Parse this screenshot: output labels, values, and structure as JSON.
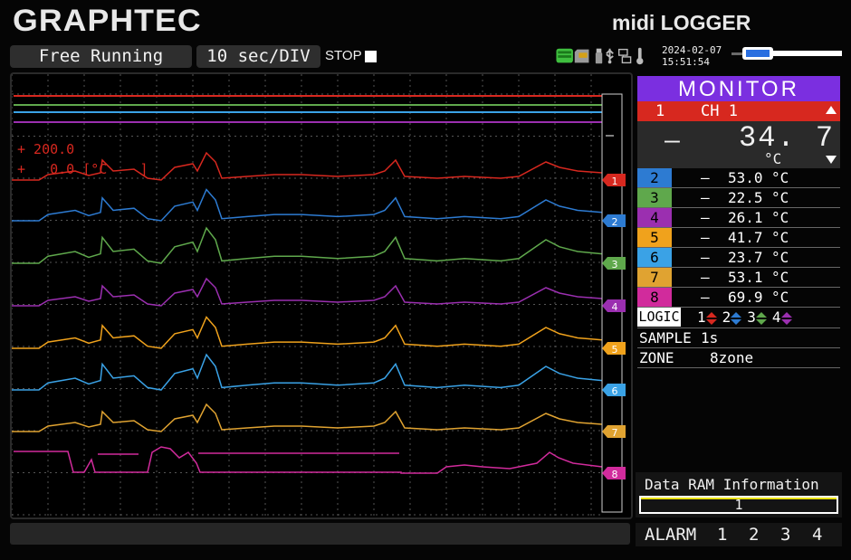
{
  "header": {
    "brand": "GRAPHTEC",
    "model": "midi LOGGER",
    "mode": "Free Running",
    "timebase": "10 sec/DIV",
    "status": "STOP",
    "date": "2024-02-07",
    "time": "15:51:54"
  },
  "status_icons": [
    "battery-icon",
    "sd-card-icon",
    "usb-memory-icon",
    "usb-icon",
    "network-icon",
    "temperature-icon"
  ],
  "graph": {
    "scale_upper": "+ 200.0",
    "scale_lower": "+   0.0 [°C    ]",
    "channel_markers": [
      "1",
      "2",
      "3",
      "4",
      "5",
      "6",
      "7",
      "8"
    ],
    "colors": [
      "#d7281f",
      "#2d7bd2",
      "#5fa84c",
      "#9b2fb0",
      "#f0a21c",
      "#3aa2e6",
      "#e0a331",
      "#d12b9c"
    ]
  },
  "monitor": {
    "title": "MONITOR",
    "selected_channel": {
      "number": "1",
      "label": "CH 1",
      "sign": "—",
      "value": "34. 7",
      "unit": "°C"
    },
    "channels": [
      {
        "number": "2",
        "sign": "—",
        "value": "53.0",
        "unit": "°C",
        "color": "#2d7bd2"
      },
      {
        "number": "3",
        "sign": "—",
        "value": "22.5",
        "unit": "°C",
        "color": "#5fa84c"
      },
      {
        "number": "4",
        "sign": "—",
        "value": "26.1",
        "unit": "°C",
        "color": "#9b2fb0"
      },
      {
        "number": "5",
        "sign": "—",
        "value": "41.7",
        "unit": "°C",
        "color": "#f0a21c"
      },
      {
        "number": "6",
        "sign": "—",
        "value": "23.7",
        "unit": "°C",
        "color": "#3aa2e6"
      },
      {
        "number": "7",
        "sign": "—",
        "value": "53.1",
        "unit": "°C",
        "color": "#e0a331"
      },
      {
        "number": "8",
        "sign": "—",
        "value": "69.9",
        "unit": "°C",
        "color": "#d12b9c"
      }
    ],
    "logic_label": "LOGIC",
    "logic_items": [
      "1",
      "2",
      "3",
      "4"
    ],
    "sample_label": "SAMPLE",
    "sample_value": "1s",
    "zone_label": "ZONE",
    "zone_value": "8zone"
  },
  "data_ram": {
    "title": "Data RAM Information",
    "value": "1"
  },
  "alarm": {
    "label": "ALARM",
    "items": [
      "1",
      "2",
      "3",
      "4"
    ]
  }
}
